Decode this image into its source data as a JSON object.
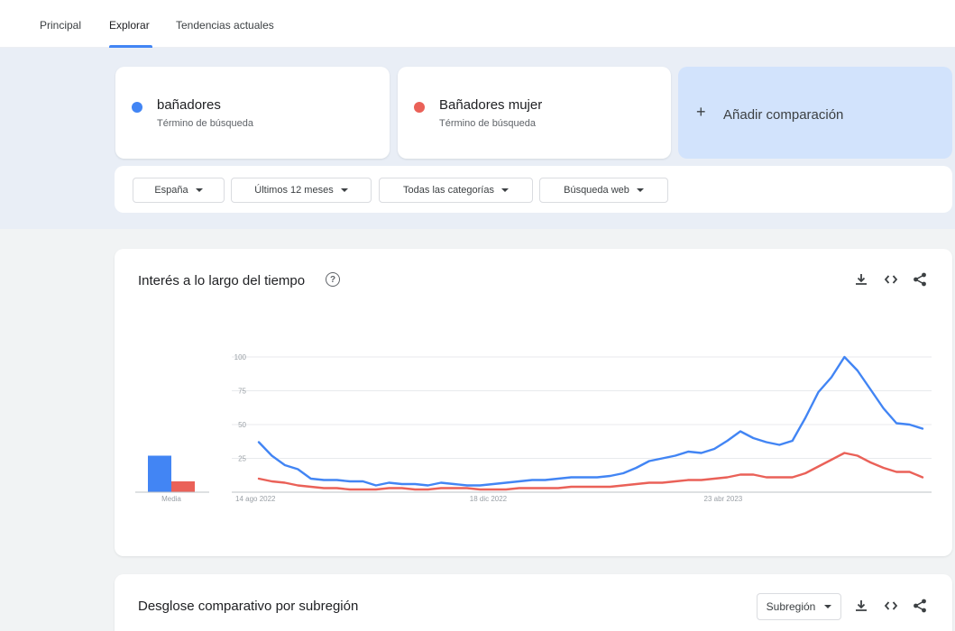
{
  "nav": {
    "items": [
      "Principal",
      "Explorar",
      "Tendencias actuales"
    ],
    "active": "Explorar"
  },
  "terms": [
    {
      "name": "bañadores",
      "sub": "Término de búsqueda",
      "color": "#4285f4"
    },
    {
      "name": "Bañadores mujer",
      "sub": "Término de búsqueda",
      "color": "#ea6158"
    }
  ],
  "add_comparison": {
    "plus": "+",
    "label": "Añadir comparación"
  },
  "filters": [
    {
      "label": "España"
    },
    {
      "label": "Últimos 12 meses"
    },
    {
      "label": "Todas las categorías"
    },
    {
      "label": "Búsqueda web"
    }
  ],
  "interest_card": {
    "title": "Interés a lo largo del tiempo",
    "help": "?",
    "icons": [
      "download-icon",
      "embed-icon",
      "share-icon"
    ]
  },
  "breakdown_card": {
    "title": "Desglose comparativo por subregión",
    "select_label": "Subregión",
    "icons": [
      "download-icon",
      "embed-icon",
      "share-icon"
    ]
  },
  "chart_data": {
    "type": "line",
    "y_ticks": [
      100,
      75,
      50,
      25
    ],
    "ylim": [
      0,
      100
    ],
    "x_tick_labels": [
      "14 ago 2022",
      "18 dic 2022",
      "23 abr 2023"
    ],
    "x_tick_index": [
      0,
      18,
      36
    ],
    "average_label": "Media",
    "averages": [
      27,
      8
    ],
    "grid": true,
    "series": [
      {
        "name": "bañadores",
        "color": "#4285f4",
        "values": [
          37,
          27,
          20,
          17,
          10,
          9,
          9,
          8,
          8,
          5,
          7,
          6,
          6,
          5,
          7,
          6,
          5,
          5,
          6,
          7,
          8,
          9,
          9,
          10,
          11,
          11,
          11,
          12,
          14,
          18,
          23,
          25,
          27,
          30,
          29,
          32,
          38,
          45,
          40,
          37,
          35,
          38,
          55,
          74,
          85,
          100,
          90,
          76,
          62,
          51,
          50,
          47
        ]
      },
      {
        "name": "Bañadores mujer",
        "color": "#ea6158",
        "values": [
          10,
          8,
          7,
          5,
          4,
          3,
          3,
          2,
          2,
          2,
          3,
          3,
          2,
          2,
          3,
          3,
          3,
          2,
          2,
          2,
          3,
          3,
          3,
          3,
          4,
          4,
          4,
          4,
          5,
          6,
          7,
          7,
          8,
          9,
          9,
          10,
          11,
          13,
          13,
          11,
          11,
          11,
          14,
          19,
          24,
          29,
          27,
          22,
          18,
          15,
          15,
          11
        ]
      }
    ]
  }
}
